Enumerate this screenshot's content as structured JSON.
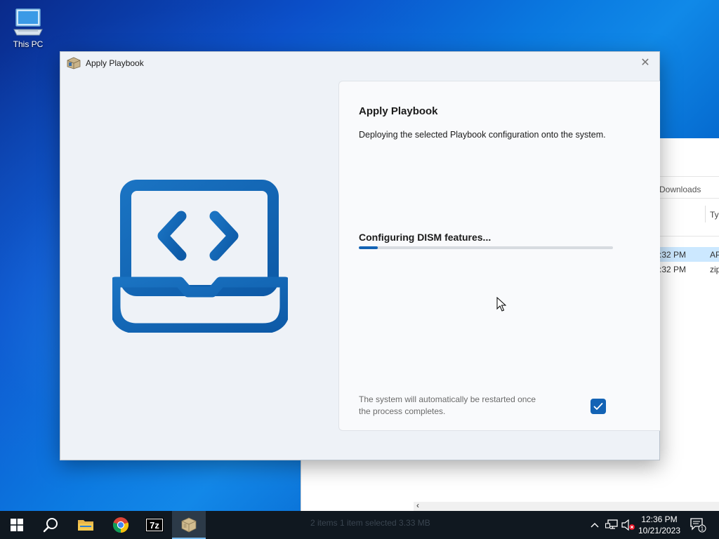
{
  "desktop": {
    "icons": [
      {
        "label": "This PC",
        "icon": "this-pc-icon"
      }
    ]
  },
  "explorer": {
    "breadcrumb_tail": "Downloads",
    "column_type": "Typ",
    "rows": [
      {
        "time": ":32 PM",
        "type": "AP",
        "selected": true
      },
      {
        "time": ":32 PM",
        "type": "zip",
        "selected": false
      }
    ],
    "status": "2 items    1 item selected  3.33 MB"
  },
  "dialog": {
    "window_title": "Apply Playbook",
    "close_glyph": "✕",
    "heading": "Apply Playbook",
    "description": "Deploying the selected Playbook configuration onto the system.",
    "status_text": "Configuring DISM features...",
    "progress_fraction": 0.075,
    "restart_note": "The system will automatically be restarted once the process completes.",
    "auto_restart_checked": true,
    "accent_color": "#1363b5",
    "hero_icon": "laptop-code-icon"
  },
  "taskbar": {
    "items": [
      {
        "name": "start-button",
        "icon": "windows-logo-icon"
      },
      {
        "name": "search-button",
        "icon": "search-icon"
      },
      {
        "name": "file-explorer-button",
        "icon": "folder-icon"
      },
      {
        "name": "chrome-button",
        "icon": "chrome-icon"
      },
      {
        "name": "7zip-button",
        "icon": "7zip-icon",
        "label": "7z"
      },
      {
        "name": "playbook-app-button",
        "icon": "package-box-icon"
      }
    ],
    "clock_time": "12:36 PM",
    "clock_date": "10/21/2023",
    "notification_count": "1"
  }
}
